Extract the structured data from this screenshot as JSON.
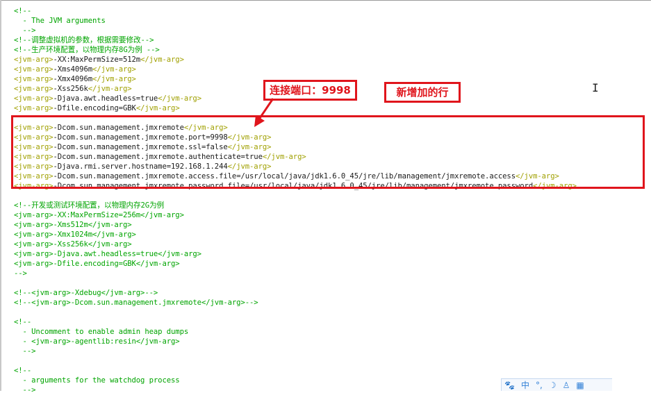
{
  "code_lines": [
    {
      "segments": [
        {
          "cls": "c",
          "text": "<!--"
        }
      ]
    },
    {
      "segments": [
        {
          "cls": "c",
          "text": "  - The JVM arguments"
        }
      ]
    },
    {
      "segments": [
        {
          "cls": "c",
          "text": "  -->"
        }
      ]
    },
    {
      "segments": [
        {
          "cls": "c",
          "text": "<!--调整虚拟机的参数，根据需要修改-->"
        }
      ]
    },
    {
      "segments": [
        {
          "cls": "c",
          "text": "<!--生产环境配置，以物理内存8G为例 -->"
        }
      ]
    },
    {
      "segments": [
        {
          "cls": "t",
          "text": "<jvm-arg>"
        },
        {
          "cls": "v",
          "text": "-XX:MaxPermSize=512m"
        },
        {
          "cls": "t",
          "text": "</jvm-arg>"
        }
      ]
    },
    {
      "segments": [
        {
          "cls": "t",
          "text": "<jvm-arg>"
        },
        {
          "cls": "v",
          "text": "-Xms4096m"
        },
        {
          "cls": "t",
          "text": "</jvm-arg>"
        }
      ]
    },
    {
      "segments": [
        {
          "cls": "t",
          "text": "<jvm-arg>"
        },
        {
          "cls": "v",
          "text": "-Xmx4096m"
        },
        {
          "cls": "t",
          "text": "</jvm-arg>"
        }
      ]
    },
    {
      "segments": [
        {
          "cls": "t",
          "text": "<jvm-arg>"
        },
        {
          "cls": "v",
          "text": "-Xss256k"
        },
        {
          "cls": "t",
          "text": "</jvm-arg>"
        }
      ]
    },
    {
      "segments": [
        {
          "cls": "t",
          "text": "<jvm-arg>"
        },
        {
          "cls": "v",
          "text": "-Djava.awt.headless=true"
        },
        {
          "cls": "t",
          "text": "</jvm-arg>"
        }
      ]
    },
    {
      "segments": [
        {
          "cls": "t",
          "text": "<jvm-arg>"
        },
        {
          "cls": "v",
          "text": "-Dfile.encoding=GBK"
        },
        {
          "cls": "t",
          "text": "</jvm-arg>"
        }
      ]
    },
    {
      "segments": []
    },
    {
      "segments": [
        {
          "cls": "t",
          "text": "<jvm-arg>"
        },
        {
          "cls": "v",
          "text": "-Dcom.sun.management.jmxremote"
        },
        {
          "cls": "t",
          "text": "</jvm-arg>"
        }
      ]
    },
    {
      "segments": [
        {
          "cls": "t",
          "text": "<jvm-arg>"
        },
        {
          "cls": "v",
          "text": "-Dcom.sun.management.jmxremote.port=9998"
        },
        {
          "cls": "t",
          "text": "</jvm-arg>"
        }
      ]
    },
    {
      "segments": [
        {
          "cls": "t",
          "text": "<jvm-arg>"
        },
        {
          "cls": "v",
          "text": "-Dcom.sun.management.jmxremote.ssl=false"
        },
        {
          "cls": "t",
          "text": "</jvm-arg>"
        }
      ]
    },
    {
      "segments": [
        {
          "cls": "t",
          "text": "<jvm-arg>"
        },
        {
          "cls": "v",
          "text": "-Dcom.sun.management.jmxremote.authenticate=true"
        },
        {
          "cls": "t",
          "text": "</jvm-arg>"
        }
      ]
    },
    {
      "segments": [
        {
          "cls": "t",
          "text": "<jvm-arg>"
        },
        {
          "cls": "v",
          "text": "-Djava.rmi.server.hostname=192.168.1.244"
        },
        {
          "cls": "t",
          "text": "</jvm-arg>"
        }
      ]
    },
    {
      "segments": [
        {
          "cls": "t",
          "text": "<jvm-arg>"
        },
        {
          "cls": "v",
          "text": "-Dcom.sun.management.jmxremote.access.file=/usr/local/java/jdk1.6.0_45/jre/lib/management/jmxremote.access"
        },
        {
          "cls": "t",
          "text": "</jvm-arg>"
        }
      ]
    },
    {
      "segments": [
        {
          "cls": "t",
          "text": "<jvm-arg>"
        },
        {
          "cls": "v",
          "text": "-Dcom.sun.management.jmxremote.password.file=/usr/local/java/jdk1.6.0_45/jre/lib/management/jmxremote.password"
        },
        {
          "cls": "t",
          "text": "</jvm-arg>"
        }
      ]
    },
    {
      "segments": []
    },
    {
      "segments": [
        {
          "cls": "c",
          "text": "<!--开发或测试环境配置，以物理内存2G为例"
        }
      ]
    },
    {
      "segments": [
        {
          "cls": "c",
          "text": "<jvm-arg>-XX:MaxPermSize=256m</jvm-arg>"
        }
      ]
    },
    {
      "segments": [
        {
          "cls": "c",
          "text": "<jvm-arg>-Xms512m</jvm-arg>"
        }
      ]
    },
    {
      "segments": [
        {
          "cls": "c",
          "text": "<jvm-arg>-Xmx1024m</jvm-arg>"
        }
      ]
    },
    {
      "segments": [
        {
          "cls": "c",
          "text": "<jvm-arg>-Xss256k</jvm-arg>"
        }
      ]
    },
    {
      "segments": [
        {
          "cls": "c",
          "text": "<jvm-arg>-Djava.awt.headless=true</jvm-arg>"
        }
      ]
    },
    {
      "segments": [
        {
          "cls": "c",
          "text": "<jvm-arg>-Dfile.encoding=GBK</jvm-arg>"
        }
      ]
    },
    {
      "segments": [
        {
          "cls": "c",
          "text": "-->"
        }
      ]
    },
    {
      "segments": []
    },
    {
      "segments": [
        {
          "cls": "c",
          "text": "<!--<jvm-arg>-Xdebug</jvm-arg>-->"
        }
      ]
    },
    {
      "segments": [
        {
          "cls": "c",
          "text": "<!--<jvm-arg>-Dcom.sun.management.jmxremote</jvm-arg>-->"
        }
      ]
    },
    {
      "segments": []
    },
    {
      "segments": [
        {
          "cls": "c",
          "text": "<!--"
        }
      ]
    },
    {
      "segments": [
        {
          "cls": "c",
          "text": "  - Uncomment to enable admin heap dumps"
        }
      ]
    },
    {
      "segments": [
        {
          "cls": "c",
          "text": "  - <jvm-arg>-agentlib:resin</jvm-arg>"
        }
      ]
    },
    {
      "segments": [
        {
          "cls": "c",
          "text": "  -->"
        }
      ]
    },
    {
      "segments": []
    },
    {
      "segments": [
        {
          "cls": "c",
          "text": "<!--"
        }
      ]
    },
    {
      "segments": [
        {
          "cls": "c",
          "text": "  - arguments for the watchdog process"
        }
      ]
    },
    {
      "segments": [
        {
          "cls": "c",
          "text": "  -->"
        }
      ]
    }
  ],
  "annotations": {
    "port_label": "连接端口：9998",
    "new_lines_label": "新增加的行"
  },
  "ime_toolbar": {
    "icons": [
      "paw-icon",
      "chinese-mode-icon",
      "punctuation-icon",
      "moon-icon",
      "user-icon",
      "grid-icon"
    ],
    "mode_label": "中"
  },
  "colors": {
    "comment": "#00a400",
    "tag": "#a0a000",
    "text": "#1a1a1a",
    "annotation": "#e0151c"
  }
}
